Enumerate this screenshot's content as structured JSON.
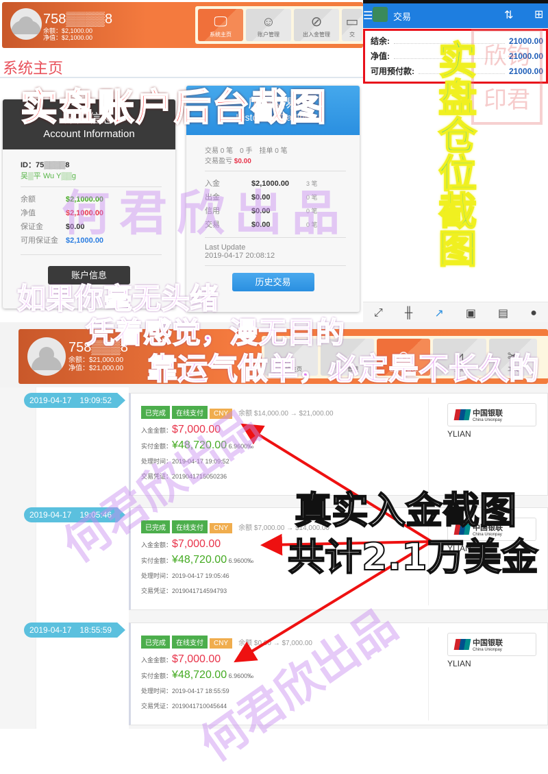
{
  "top_header": {
    "account_id": "758▒▒▒▒8",
    "balance": "余额：$2,1000.00",
    "equity": "净值：$2,1000.00",
    "nav": [
      {
        "label": "系统主页",
        "icon": "monitor-icon",
        "active": true
      },
      {
        "label": "账户管理",
        "icon": "user-icon"
      },
      {
        "label": "出入金管理",
        "icon": "compass-icon"
      },
      {
        "label": "交",
        "icon": "chart-icon"
      }
    ]
  },
  "page_title": "系统主页",
  "account_card": {
    "title_cn": "账户信息",
    "title_en": "Account Information",
    "id": "ID：75▒▒▒▒8",
    "name": "吴▒平 Wu Y▒▒g",
    "rows": [
      {
        "label": "余额",
        "value": "$2,1000.00",
        "color": "#44aa22"
      },
      {
        "label": "净值",
        "value": "$2,1000.00",
        "color": "#e8334a"
      },
      {
        "label": "保证金",
        "value": "$0.00",
        "color": "#333333"
      },
      {
        "label": "可用保证金",
        "value": "$2,1000.00",
        "color": "#2a7de1"
      }
    ],
    "button": "账户信息"
  },
  "history_card": {
    "title_cn": "历史交易",
    "title_en": "Historical Trading",
    "summary1": "交易 0 笔　0 手　挂单 0 笔",
    "summary2_label": "交易盈亏",
    "summary2_value": "$0.00",
    "rows": [
      {
        "label": "入金",
        "value": "$2,1000.00",
        "count": "3 笔"
      },
      {
        "label": "出金",
        "value": "$0.00",
        "count": "0 笔"
      },
      {
        "label": "信用",
        "value": "$0.00",
        "count": "0 笔"
      },
      {
        "label": "交易",
        "value": "$0.00",
        "count": "0 笔"
      }
    ],
    "last_update_label": "Last Update",
    "last_update": "2019-04-17 20:08:12",
    "button": "历史交易"
  },
  "mobile": {
    "title": "交易",
    "rows": [
      {
        "label": "结余:",
        "value": "21000.00"
      },
      {
        "label": "净值:",
        "value": "21000.00"
      },
      {
        "label": "可用预付款:",
        "value": "21000.00"
      }
    ],
    "toolbar": [
      "exchange-icon",
      "candlestick-icon",
      "trend-icon",
      "inbox-icon",
      "news-icon",
      "chat-icon"
    ]
  },
  "second_header": {
    "account_id": "758▒▒▒8",
    "balance": "余额：$21,000.00",
    "equity": "净值：$21,000.00",
    "nav": [
      {
        "label": "系统主页"
      },
      {
        "label": "账户管理"
      },
      {
        "label": "出入金管理",
        "active": true
      },
      {
        "label": "交易"
      },
      {
        "label": "工具"
      }
    ]
  },
  "deposits": [
    {
      "time": "2019-04-17　19:09:52",
      "balance_change": "余额 $14,000.00 → $21,000.00",
      "amount": "$7,000.00",
      "paid": "¥48,720.00",
      "rate": "6.9600‰",
      "processed": "2019-04-17 19:09:52",
      "voucher": "2019041715050236"
    },
    {
      "time": "2019-04-17　19:05:46",
      "balance_change": "余额 $7,000.00 → $14,000.00",
      "amount": "$7,000.00",
      "paid": "¥48,720.00",
      "rate": "6.9600‰",
      "processed": "2019-04-17 19:05:46",
      "voucher": "2019041714594793"
    },
    {
      "time": "2019-04-17　18:55:59",
      "balance_change": "余额 $0.00 → $7,000.00",
      "amount": "$7,000.00",
      "paid": "¥48,720.00",
      "rate": "6.9600‰",
      "processed": "2019-04-17 18:55:59",
      "voucher": "2019041710045644"
    }
  ],
  "deposit_labels": {
    "status": "已完成",
    "method": "在线支付",
    "currency": "CNY",
    "amount": "入金金额：",
    "paid": "实付金额：",
    "processed": "处理时间：",
    "voucher": "交易凭证：",
    "channel": "YLIAN",
    "bank_cn": "中国银联",
    "bank_en": "China Unionpay"
  },
  "overlays": {
    "red_caption": "实盘账户后台截图",
    "yellow_caption": "实盘仓位截图",
    "stamp": "欣钧印君",
    "purple": [
      "如果你毫无头绪",
      "凭着感觉，漫无目的",
      "靠运气做单，必定是不长久的"
    ],
    "black": [
      "真实入金截图",
      "共计2.1万美金"
    ],
    "watermark": "何君欣出品"
  },
  "colors": {
    "orange": "#f37c3c",
    "blue": "#2a8fe0",
    "red": "#e8334a",
    "green": "#44aa22"
  }
}
